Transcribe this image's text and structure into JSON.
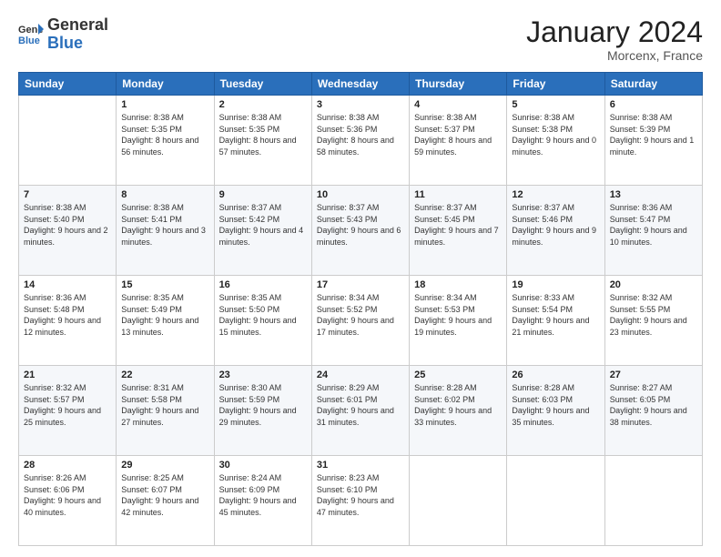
{
  "header": {
    "logo_line1": "General",
    "logo_line2": "Blue",
    "month": "January 2024",
    "location": "Morcenx, France"
  },
  "days_of_week": [
    "Sunday",
    "Monday",
    "Tuesday",
    "Wednesday",
    "Thursday",
    "Friday",
    "Saturday"
  ],
  "weeks": [
    [
      {
        "day": "",
        "sunrise": "",
        "sunset": "",
        "daylight": ""
      },
      {
        "day": "1",
        "sunrise": "Sunrise: 8:38 AM",
        "sunset": "Sunset: 5:35 PM",
        "daylight": "Daylight: 8 hours and 56 minutes."
      },
      {
        "day": "2",
        "sunrise": "Sunrise: 8:38 AM",
        "sunset": "Sunset: 5:35 PM",
        "daylight": "Daylight: 8 hours and 57 minutes."
      },
      {
        "day": "3",
        "sunrise": "Sunrise: 8:38 AM",
        "sunset": "Sunset: 5:36 PM",
        "daylight": "Daylight: 8 hours and 58 minutes."
      },
      {
        "day": "4",
        "sunrise": "Sunrise: 8:38 AM",
        "sunset": "Sunset: 5:37 PM",
        "daylight": "Daylight: 8 hours and 59 minutes."
      },
      {
        "day": "5",
        "sunrise": "Sunrise: 8:38 AM",
        "sunset": "Sunset: 5:38 PM",
        "daylight": "Daylight: 9 hours and 0 minutes."
      },
      {
        "day": "6",
        "sunrise": "Sunrise: 8:38 AM",
        "sunset": "Sunset: 5:39 PM",
        "daylight": "Daylight: 9 hours and 1 minute."
      }
    ],
    [
      {
        "day": "7",
        "sunrise": "Sunrise: 8:38 AM",
        "sunset": "Sunset: 5:40 PM",
        "daylight": "Daylight: 9 hours and 2 minutes."
      },
      {
        "day": "8",
        "sunrise": "Sunrise: 8:38 AM",
        "sunset": "Sunset: 5:41 PM",
        "daylight": "Daylight: 9 hours and 3 minutes."
      },
      {
        "day": "9",
        "sunrise": "Sunrise: 8:37 AM",
        "sunset": "Sunset: 5:42 PM",
        "daylight": "Daylight: 9 hours and 4 minutes."
      },
      {
        "day": "10",
        "sunrise": "Sunrise: 8:37 AM",
        "sunset": "Sunset: 5:43 PM",
        "daylight": "Daylight: 9 hours and 6 minutes."
      },
      {
        "day": "11",
        "sunrise": "Sunrise: 8:37 AM",
        "sunset": "Sunset: 5:45 PM",
        "daylight": "Daylight: 9 hours and 7 minutes."
      },
      {
        "day": "12",
        "sunrise": "Sunrise: 8:37 AM",
        "sunset": "Sunset: 5:46 PM",
        "daylight": "Daylight: 9 hours and 9 minutes."
      },
      {
        "day": "13",
        "sunrise": "Sunrise: 8:36 AM",
        "sunset": "Sunset: 5:47 PM",
        "daylight": "Daylight: 9 hours and 10 minutes."
      }
    ],
    [
      {
        "day": "14",
        "sunrise": "Sunrise: 8:36 AM",
        "sunset": "Sunset: 5:48 PM",
        "daylight": "Daylight: 9 hours and 12 minutes."
      },
      {
        "day": "15",
        "sunrise": "Sunrise: 8:35 AM",
        "sunset": "Sunset: 5:49 PM",
        "daylight": "Daylight: 9 hours and 13 minutes."
      },
      {
        "day": "16",
        "sunrise": "Sunrise: 8:35 AM",
        "sunset": "Sunset: 5:50 PM",
        "daylight": "Daylight: 9 hours and 15 minutes."
      },
      {
        "day": "17",
        "sunrise": "Sunrise: 8:34 AM",
        "sunset": "Sunset: 5:52 PM",
        "daylight": "Daylight: 9 hours and 17 minutes."
      },
      {
        "day": "18",
        "sunrise": "Sunrise: 8:34 AM",
        "sunset": "Sunset: 5:53 PM",
        "daylight": "Daylight: 9 hours and 19 minutes."
      },
      {
        "day": "19",
        "sunrise": "Sunrise: 8:33 AM",
        "sunset": "Sunset: 5:54 PM",
        "daylight": "Daylight: 9 hours and 21 minutes."
      },
      {
        "day": "20",
        "sunrise": "Sunrise: 8:32 AM",
        "sunset": "Sunset: 5:55 PM",
        "daylight": "Daylight: 9 hours and 23 minutes."
      }
    ],
    [
      {
        "day": "21",
        "sunrise": "Sunrise: 8:32 AM",
        "sunset": "Sunset: 5:57 PM",
        "daylight": "Daylight: 9 hours and 25 minutes."
      },
      {
        "day": "22",
        "sunrise": "Sunrise: 8:31 AM",
        "sunset": "Sunset: 5:58 PM",
        "daylight": "Daylight: 9 hours and 27 minutes."
      },
      {
        "day": "23",
        "sunrise": "Sunrise: 8:30 AM",
        "sunset": "Sunset: 5:59 PM",
        "daylight": "Daylight: 9 hours and 29 minutes."
      },
      {
        "day": "24",
        "sunrise": "Sunrise: 8:29 AM",
        "sunset": "Sunset: 6:01 PM",
        "daylight": "Daylight: 9 hours and 31 minutes."
      },
      {
        "day": "25",
        "sunrise": "Sunrise: 8:28 AM",
        "sunset": "Sunset: 6:02 PM",
        "daylight": "Daylight: 9 hours and 33 minutes."
      },
      {
        "day": "26",
        "sunrise": "Sunrise: 8:28 AM",
        "sunset": "Sunset: 6:03 PM",
        "daylight": "Daylight: 9 hours and 35 minutes."
      },
      {
        "day": "27",
        "sunrise": "Sunrise: 8:27 AM",
        "sunset": "Sunset: 6:05 PM",
        "daylight": "Daylight: 9 hours and 38 minutes."
      }
    ],
    [
      {
        "day": "28",
        "sunrise": "Sunrise: 8:26 AM",
        "sunset": "Sunset: 6:06 PM",
        "daylight": "Daylight: 9 hours and 40 minutes."
      },
      {
        "day": "29",
        "sunrise": "Sunrise: 8:25 AM",
        "sunset": "Sunset: 6:07 PM",
        "daylight": "Daylight: 9 hours and 42 minutes."
      },
      {
        "day": "30",
        "sunrise": "Sunrise: 8:24 AM",
        "sunset": "Sunset: 6:09 PM",
        "daylight": "Daylight: 9 hours and 45 minutes."
      },
      {
        "day": "31",
        "sunrise": "Sunrise: 8:23 AM",
        "sunset": "Sunset: 6:10 PM",
        "daylight": "Daylight: 9 hours and 47 minutes."
      },
      {
        "day": "",
        "sunrise": "",
        "sunset": "",
        "daylight": ""
      },
      {
        "day": "",
        "sunrise": "",
        "sunset": "",
        "daylight": ""
      },
      {
        "day": "",
        "sunrise": "",
        "sunset": "",
        "daylight": ""
      }
    ]
  ]
}
